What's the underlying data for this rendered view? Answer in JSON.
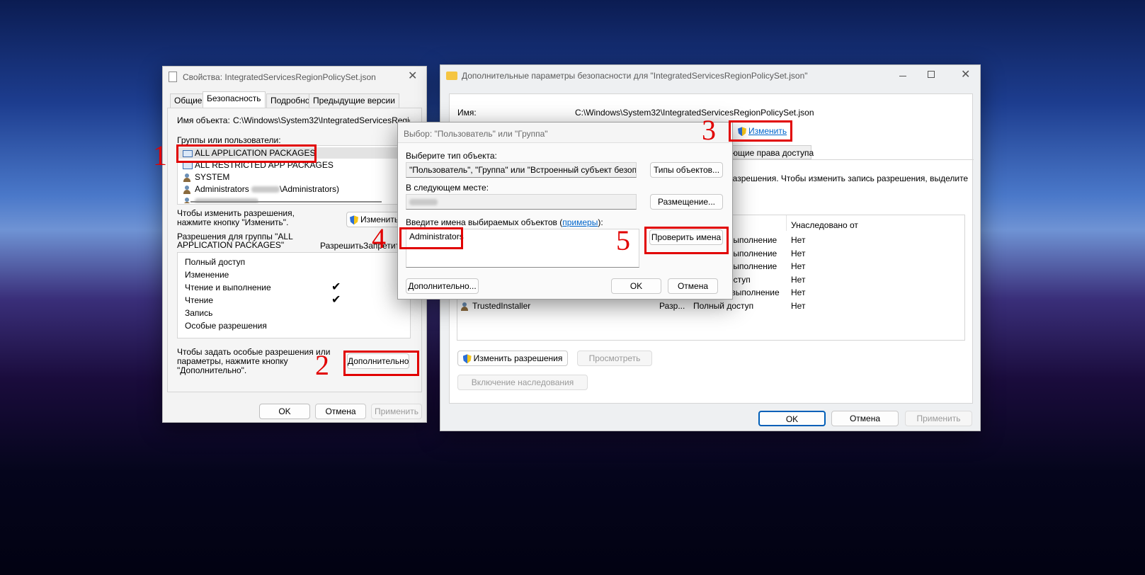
{
  "props": {
    "title": "Свойства: IntegratedServicesRegionPolicySet.json",
    "tabs": [
      "Общие",
      "Безопасность",
      "Подробно",
      "Предыдущие версии"
    ],
    "object_name_label": "Имя объекта:",
    "object_name_value": "C:\\Windows\\System32\\IntegratedServicesRegionPoli",
    "groups_label": "Группы или пользователи:",
    "groups": [
      {
        "icon": "package-icon",
        "name": "ALL APPLICATION PACKAGES"
      },
      {
        "icon": "package-icon",
        "name": "ALL RESTRICTED APP PACKAGES"
      },
      {
        "icon": "users-icon",
        "name": "SYSTEM"
      },
      {
        "icon": "users-icon",
        "name": "Administrators",
        "suffix": "\\Administrators)"
      }
    ],
    "change_hint": "Чтобы изменить разрешения,\nнажмите кнопку \"Изменить\".",
    "change_button": "Изменить...",
    "perm_group_label": "Разрешения для группы \"ALL\nAPPLICATION PACKAGES\"",
    "col_allow": "Разрешить",
    "col_deny": "Запретить",
    "permissions": [
      {
        "name": "Полный доступ",
        "allow": false
      },
      {
        "name": "Изменение",
        "allow": false
      },
      {
        "name": "Чтение и выполнение",
        "allow": true
      },
      {
        "name": "Чтение",
        "allow": true
      },
      {
        "name": "Запись",
        "allow": false
      },
      {
        "name": "Особые разрешения",
        "allow": false
      }
    ],
    "check_mark": "✔",
    "advanced_hint": "Чтобы задать особые разрешения или\nпараметры, нажмите кнопку\n\"Дополнительно\".",
    "advanced_button": "Дополнительно",
    "ok": "OK",
    "cancel": "Отмена",
    "apply": "Применить"
  },
  "adv": {
    "title": "Дополнительные параметры безопасности  для \"IntegratedServicesRegionPolicySet.json\"",
    "name_label": "Имя:",
    "name_value": "C:\\Windows\\System32\\IntegratedServicesRegionPolicySet.json",
    "change_link": "Изменить",
    "tab_partial": "ющие права доступа",
    "desc_partial": "разрешения. Чтобы изменить запись разрешения, выделите",
    "col_inherited": "Унаследовано от",
    "rows": [
      {
        "name": "",
        "type": "",
        "access": "выполнение",
        "inherited": "Нет"
      },
      {
        "name": "",
        "type": "",
        "access": "выполнение",
        "inherited": "Нет"
      },
      {
        "name": "",
        "type": "",
        "access": "выполнение",
        "inherited": "Нет"
      },
      {
        "name": "",
        "type": "",
        "access": "оступ",
        "inherited": "Нет"
      },
      {
        "name": "",
        "type": "Разр...",
        "access": "Чтение и выполнение",
        "inherited": "Нет"
      },
      {
        "name": "TrustedInstaller",
        "type": "Разр...",
        "access": "Полный доступ",
        "inherited": "Нет"
      }
    ],
    "change_perms_button": "Изменить разрешения",
    "view_button": "Просмотреть",
    "enable_inheritance_button": "Включение наследования",
    "ok": "OK",
    "cancel": "Отмена",
    "apply": "Применить"
  },
  "select": {
    "title": "Выбор: \"Пользователь\" или \"Группа\"",
    "type_label": "Выберите тип объекта:",
    "type_value": "\"Пользователь\", \"Группа\" или \"Встроенный субъект безопасност",
    "types_button": "Типы объектов...",
    "location_label": "В следующем месте:",
    "location_button": "Размещение...",
    "names_label": "Введите имена выбираемых объектов (",
    "names_link": "примеры",
    "names_label_end": "):",
    "names_value": "Administrators",
    "check_button": "Проверить имена",
    "advanced_button": "Дополнительно...",
    "ok": "OK",
    "cancel": "Отмена"
  },
  "steps": [
    "1",
    "2",
    "3",
    "4",
    "5"
  ],
  "colors": {
    "annotation_red": "#e10000",
    "accent": "#005fb8"
  }
}
